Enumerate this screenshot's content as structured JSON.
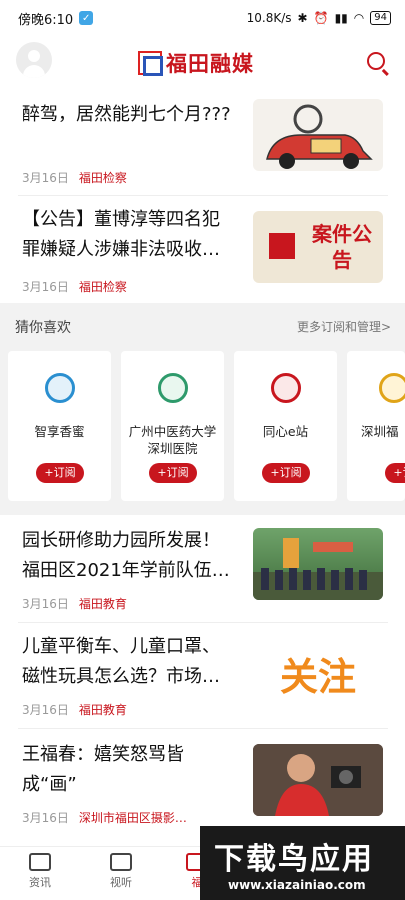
{
  "status_bar": {
    "time": "傍晚6:10",
    "net_speed": "10.8K/s",
    "battery": "94"
  },
  "header": {
    "brand": "福田融媒"
  },
  "news_top": [
    {
      "title": "醉驾，居然能判七个月???",
      "date": "3月16日",
      "source": "福田检察"
    },
    {
      "title": "【公告】董博淳等四名犯罪嫌疑人涉嫌非法吸收…",
      "date": "3月16日",
      "source": "福田检察",
      "thumb_text": "案件公告"
    }
  ],
  "guess": {
    "heading": "猜你喜欢",
    "more": "更多订阅和管理>",
    "cards": [
      {
        "name": "智享香蜜",
        "button": "+订阅"
      },
      {
        "name": "广州中医药大学深圳医院",
        "button": "+订阅"
      },
      {
        "name": "同心e站",
        "button": "+订阅"
      },
      {
        "name": "深圳福",
        "button": "+订阅"
      }
    ]
  },
  "news_bottom": [
    {
      "title": "园长研修助力园所发展！福田区2021年学前队伍…",
      "date": "3月16日",
      "source": "福田教育"
    },
    {
      "title": "儿童平衡车、儿童口罩、磁性玩具怎么选？市场…",
      "date": "3月16日",
      "source": "福田教育",
      "thumb_text": "关注"
    },
    {
      "title": "王福春：嬉笑怒骂皆成“画”",
      "date": "3月16日",
      "source": "深圳市福田区摄影…"
    }
  ],
  "tabs": [
    {
      "label": "资讯"
    },
    {
      "label": "视听"
    },
    {
      "label": "福"
    }
  ],
  "watermark": {
    "big": "下载鸟应用",
    "url": "www.xiazainiao.com"
  },
  "colors": {
    "accent": "#c8161e"
  }
}
